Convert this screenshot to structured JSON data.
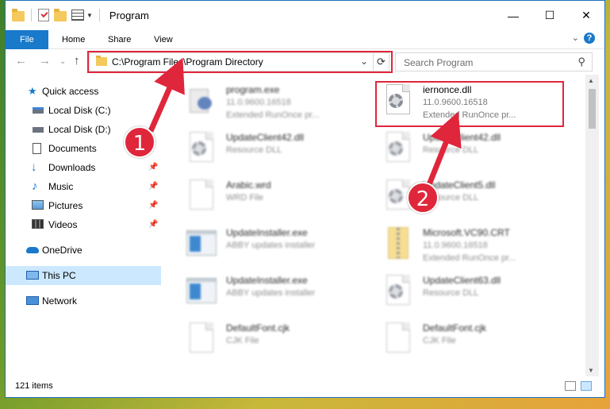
{
  "window": {
    "title": "Program",
    "buttons": {
      "minimize": "—",
      "maximize": "☐",
      "close": "✕"
    }
  },
  "ribbon": {
    "tabs": [
      "File",
      "Home",
      "Share",
      "View"
    ],
    "expand_glyph": "⌄",
    "help_glyph": "?"
  },
  "nav_buttons": {
    "back": "←",
    "forward": "→",
    "recent": "⌄",
    "up": "↑"
  },
  "address": {
    "path": "C:\\Program Files\\Program Directory",
    "chevron": "⌄",
    "refresh": "⟳"
  },
  "search": {
    "placeholder": "Search Program",
    "icon": "search-icon"
  },
  "nav_pane": {
    "items": [
      {
        "label": "Quick access",
        "icon": "star-icon",
        "pinned": false
      },
      {
        "label": "Local Disk (C:)",
        "icon": "drive-icon",
        "pinned": false
      },
      {
        "label": "Local Disk (D:)",
        "icon": "drive-icon",
        "pinned": false
      },
      {
        "label": "Documents",
        "icon": "documents-icon",
        "pinned": false
      },
      {
        "label": "Downloads",
        "icon": "download-icon",
        "pinned": true
      },
      {
        "label": "Music",
        "icon": "music-icon",
        "pinned": true
      },
      {
        "label": "Pictures",
        "icon": "pictures-icon",
        "pinned": true
      },
      {
        "label": "Videos",
        "icon": "videos-icon",
        "pinned": true
      },
      {
        "label": "OneDrive",
        "icon": "cloud-icon",
        "pinned": false
      },
      {
        "label": "This PC",
        "icon": "computer-icon",
        "pinned": false,
        "selected": true
      },
      {
        "label": "Network",
        "icon": "network-icon",
        "pinned": false
      }
    ]
  },
  "files": [
    {
      "name": "program.exe",
      "line2": "11.0.9600.16518",
      "line3": "Extended RunOnce pr...",
      "icon": "exe-icon"
    },
    {
      "name": "iernonce.dll",
      "line2": "11.0.9600.16518",
      "line3": "Extended RunOnce pr...",
      "icon": "dll-gear-icon",
      "highlighted": true
    },
    {
      "name": "UpdateClient42.dll",
      "line2": "Resource DLL",
      "line3": "",
      "icon": "dll-gear-icon"
    },
    {
      "name": "UpdateClient42.dll",
      "line2": "Resource DLL",
      "line3": "",
      "icon": "dll-gear-icon"
    },
    {
      "name": "Arabic.wrd",
      "line2": "WRD File",
      "line3": "",
      "icon": "blank-doc-icon"
    },
    {
      "name": "UpdateClient5.dll",
      "line2": "Resource DLL",
      "line3": "",
      "icon": "dll-gear-icon"
    },
    {
      "name": "UpdateInstaller.exe",
      "line2": "ABBY updates installer",
      "line3": "",
      "icon": "app-window-icon"
    },
    {
      "name": "Microsoft.VC90.CRT",
      "line2": "11.0.9600.16518",
      "line3": "Extended RunOnce pr...",
      "icon": "zip-folder-icon"
    },
    {
      "name": "UpdateInstaller.exe",
      "line2": "ABBY updates installer",
      "line3": "",
      "icon": "app-window-icon"
    },
    {
      "name": "UpdateClient63.dll",
      "line2": "Resource DLL",
      "line3": "",
      "icon": "dll-gear-icon"
    },
    {
      "name": "DefaultFont.cjk",
      "line2": "CJK File",
      "line3": "",
      "icon": "blank-doc-icon"
    },
    {
      "name": "DefaultFont.cjk",
      "line2": "CJK File",
      "line3": "",
      "icon": "blank-doc-icon"
    }
  ],
  "status": {
    "item_count": "121 items"
  },
  "annotations": {
    "callout_1": "1",
    "callout_2": "2",
    "color": "#e0263b"
  },
  "colors": {
    "accent": "#1979ca",
    "selected": "#cce8ff",
    "highlight": "#e0263b"
  }
}
